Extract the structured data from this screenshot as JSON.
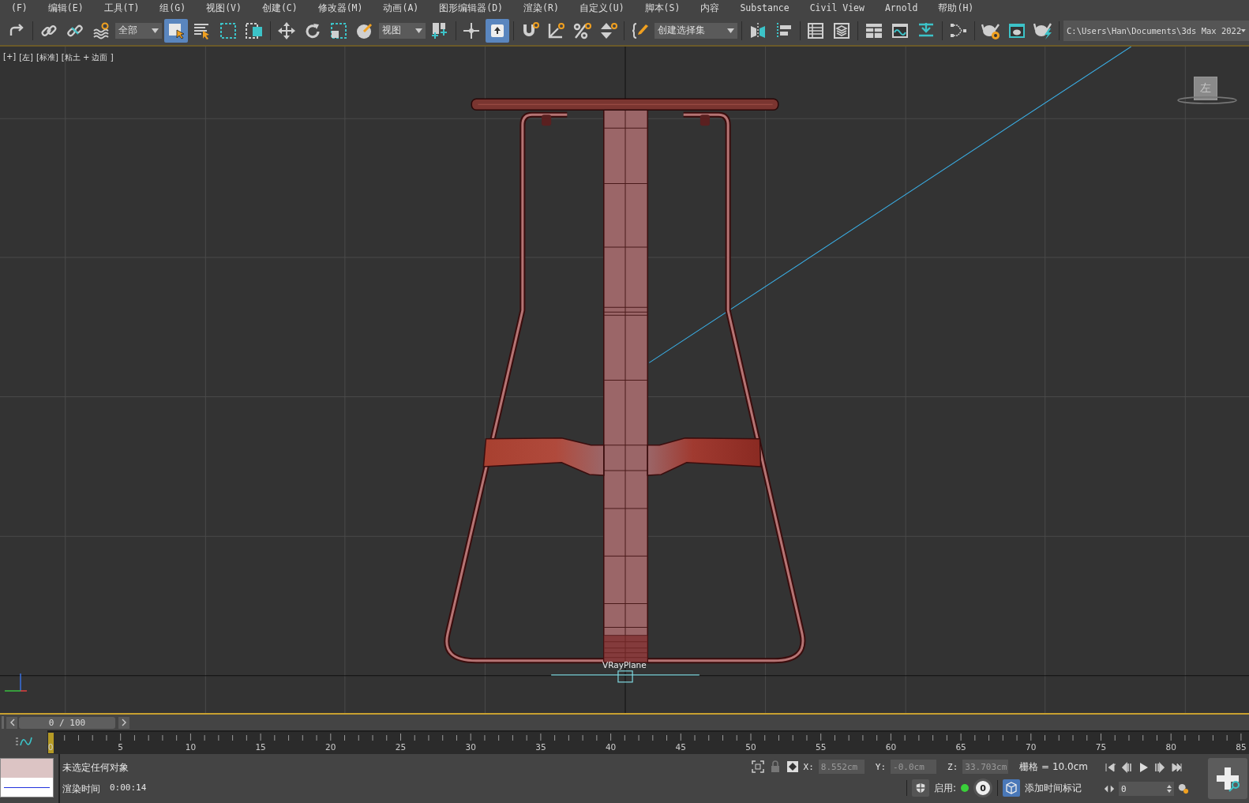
{
  "menu_bar": {
    "items": [
      "(F)",
      "编辑(E)",
      "工具(T)",
      "组(G)",
      "视图(V)",
      "创建(C)",
      "修改器(M)",
      "动画(A)",
      "图形编辑器(D)",
      "渲染(R)",
      "自定义(U)",
      "脚本(S)",
      "内容",
      "Substance",
      "Civil View",
      "Arnold",
      "帮助(H)"
    ]
  },
  "toolbar": {
    "items": [
      {
        "kind": "button",
        "selected": false
      },
      {
        "kind": "separator"
      },
      {
        "kind": "button",
        "selected": false
      },
      {
        "kind": "button",
        "selected": false
      },
      {
        "kind": "button",
        "selected": false
      },
      {
        "kind": "dropdown",
        "value": "全部"
      },
      {
        "kind": "button",
        "selected": true
      },
      {
        "kind": "button",
        "selected": false
      },
      {
        "kind": "button",
        "selected": false
      },
      {
        "kind": "button",
        "selected": false
      },
      {
        "kind": "separator"
      },
      {
        "kind": "button",
        "selected": false
      },
      {
        "kind": "button",
        "selected": false
      },
      {
        "kind": "button",
        "selected": false
      },
      {
        "kind": "button",
        "selected": false
      },
      {
        "kind": "dropdown",
        "value": "视图"
      },
      {
        "kind": "button",
        "selected": false
      },
      {
        "kind": "separator"
      },
      {
        "kind": "button",
        "selected": false
      },
      {
        "kind": "button",
        "selected": true
      },
      {
        "kind": "separator"
      },
      {
        "kind": "button",
        "selected": false
      },
      {
        "kind": "button",
        "selected": false
      },
      {
        "kind": "button",
        "selected": false
      },
      {
        "kind": "button",
        "selected": false
      },
      {
        "kind": "separator"
      },
      {
        "kind": "button",
        "selected": false
      },
      {
        "kind": "dropdown",
        "value": "创建选择集"
      },
      {
        "kind": "separator"
      },
      {
        "kind": "button",
        "selected": false
      },
      {
        "kind": "button",
        "selected": false
      },
      {
        "kind": "separator"
      },
      {
        "kind": "button",
        "selected": false
      },
      {
        "kind": "button",
        "selected": false
      },
      {
        "kind": "separator"
      },
      {
        "kind": "button",
        "selected": false
      },
      {
        "kind": "button",
        "selected": false
      },
      {
        "kind": "button",
        "selected": false
      },
      {
        "kind": "separator"
      },
      {
        "kind": "button",
        "selected": false
      },
      {
        "kind": "separator"
      },
      {
        "kind": "button",
        "selected": false
      },
      {
        "kind": "button",
        "selected": false
      },
      {
        "kind": "button",
        "selected": false
      },
      {
        "kind": "separator"
      },
      {
        "kind": "dropdown",
        "value": "C:\\Users\\Han\\Documents\\3ds Max 2022"
      }
    ]
  },
  "viewport": {
    "labels": [
      "[+]",
      "[左]",
      "[标准]",
      "[粘土 + 边面 ]"
    ],
    "view_cube": "左",
    "object_label": "VRayPlane"
  },
  "time_slider": {
    "text": "0 / 100",
    "level": 0
  },
  "track_bar": {
    "labels": [
      "0",
      "5",
      "10",
      "15",
      "20",
      "25",
      "30",
      "35",
      "40",
      "45",
      "50",
      "55",
      "60",
      "65",
      "70",
      "75",
      "80",
      "85"
    ]
  },
  "status_bar": {
    "prompt": "未选定任何对象",
    "render_time_label": "渲染时间",
    "render_time": "0:00:14",
    "x_label": "X:",
    "x": "8.552cm",
    "y_label": "Y:",
    "y": "-0.0cm",
    "z_label": "Z:",
    "z": "33.703cm",
    "grid": "栅格 = 10.0cm",
    "enabled_label": "启用:",
    "enabled": true,
    "enabled_count": "0",
    "add_time_tag": "添加时间标记",
    "frame": "0"
  }
}
